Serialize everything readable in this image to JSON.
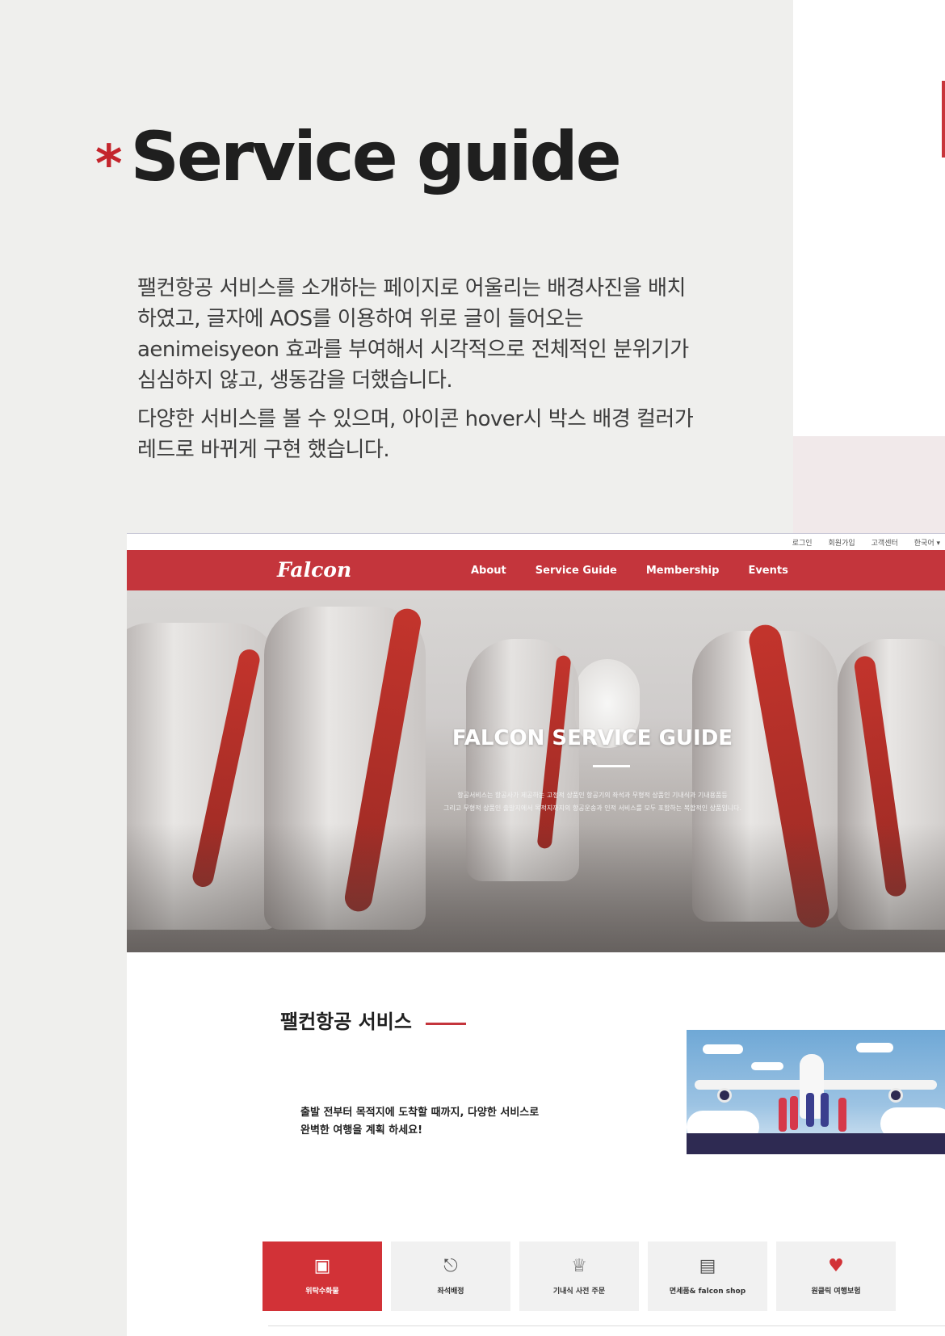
{
  "heading": {
    "asterisk": "*",
    "title": "Service guide"
  },
  "description": {
    "paragraph1": "팰컨항공 서비스를 소개하는 페이지로 어울리는 배경사진을 배치하였고, 글자에 AOS를 이용하여 위로 글이 들어오는 aenimeisyeon 효과를 부여해서 시각적으로 전체적인 분위기가 심심하지 않고, 생동감을 더했습니다.",
    "paragraph2": "다양한 서비스를 볼 수 있으며, 아이콘 hover시 박스 배경 컬러가 레드로 바뀌게 구현 했습니다."
  },
  "mockup": {
    "utility": [
      "로그인",
      "회원가입",
      "고객센터",
      "한국어 ▾"
    ],
    "logo": "Falcon",
    "nav": [
      "About",
      "Service Guide",
      "Membership",
      "Events"
    ],
    "hero": {
      "title": "FALCON SERVICE GUIDE",
      "subtitle_line1": "항공서비스는 항공사가 제공하는 고정적 상품인 항공기의 좌석과 무형적 상품인 기내식과 기내용품등",
      "subtitle_line2": "그리고 무형적 상품인 출발지에서 목적지까지의 항공운송과 인적 서비스를 모두 포함하는 복합적인 상품입니다."
    },
    "section_title": "팰컨항공 서비스",
    "intro_line1": "출발 전부터 목적지에 도착할 때까지, 다양한 서비스로",
    "intro_line2": "완벽한 여행을 계획 하세요!",
    "services": [
      {
        "label": "위탁수화물",
        "icon": "luggage-icon",
        "active": true
      },
      {
        "label": "좌석배정",
        "icon": "seat-icon",
        "active": false
      },
      {
        "label": "기내식 사전 주문",
        "icon": "utensils-icon",
        "active": false
      },
      {
        "label": "면세품& falcon shop",
        "icon": "shopping-bag-icon",
        "active": false
      },
      {
        "label": "원클릭 여행보험",
        "icon": "heart-hand-icon",
        "active": false
      }
    ]
  },
  "colors": {
    "accent": "#c4353c",
    "background": "#efefed"
  }
}
